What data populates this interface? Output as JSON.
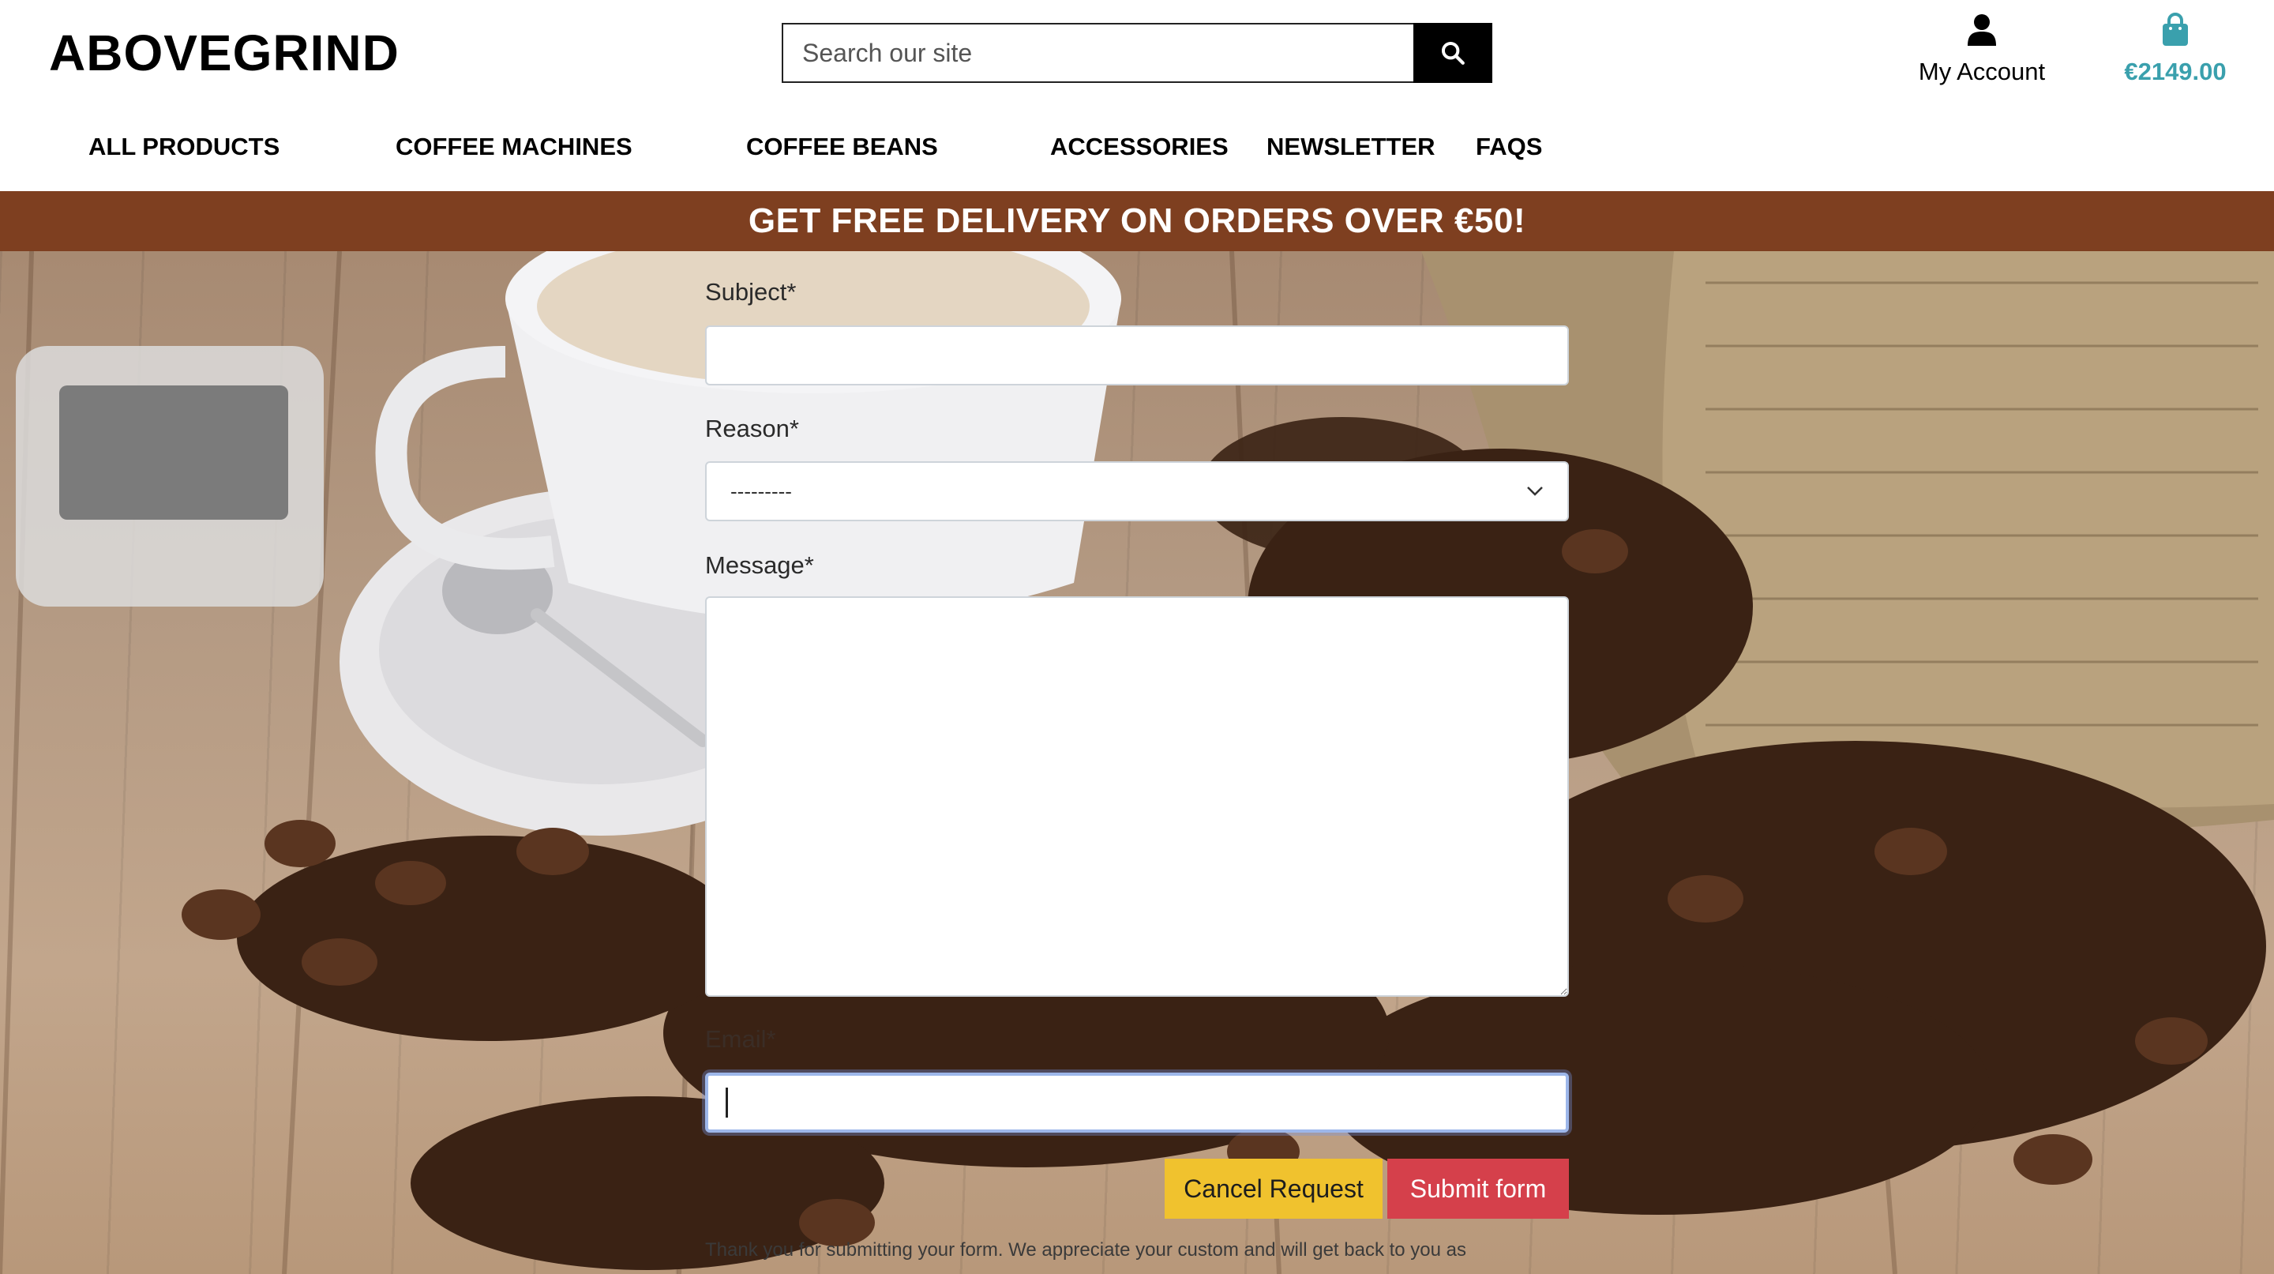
{
  "header": {
    "logo": "ABOVEGRIND",
    "search_placeholder": "Search our site",
    "search_icon": "search-icon",
    "account_icon": "user-icon",
    "account_label": "My Account",
    "bag_icon": "shopping-bag-icon",
    "bag_total": "€2149.00"
  },
  "nav": {
    "items": [
      "ALL PRODUCTS",
      "COFFEE MACHINES",
      "COFFEE BEANS",
      "ACCESSORIES",
      "NEWSLETTER",
      "FAQS"
    ]
  },
  "banner": {
    "text": "GET FREE DELIVERY ON ORDERS OVER €50!"
  },
  "form": {
    "subject_label": "Subject*",
    "reason_label": "Reason*",
    "reason_selected": "---------",
    "reason_icon": "chevron-down-icon",
    "message_label": "Message*",
    "email_label": "Email*",
    "cancel_label": "Cancel Request",
    "submit_label": "Submit form",
    "note": "Thank you for submitting your form. We appreciate your custom and will get back to you as"
  },
  "colors": {
    "banner": "#7e3f20",
    "cart_total": "#3aa0ad",
    "cancel_button": "#f0c22e",
    "submit_button": "#d5404b"
  }
}
